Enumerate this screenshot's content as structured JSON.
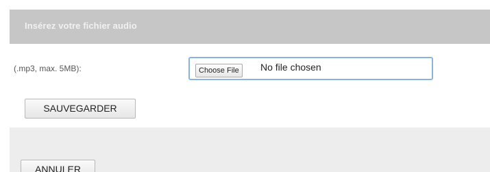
{
  "header": {
    "title": "Insérez votre fichier audio"
  },
  "form": {
    "format_hint": "(.mp3, max. 5MB):",
    "file_input": {
      "button_label": "Choose File",
      "status_text": "No file chosen"
    },
    "save_label": "SAUVEGARDER"
  },
  "footer": {
    "cancel_label": "ANNULER"
  }
}
